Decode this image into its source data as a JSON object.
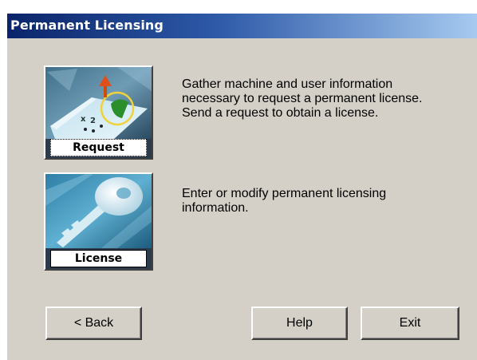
{
  "window": {
    "title": "Permanent Licensing"
  },
  "options": [
    {
      "label": "Request",
      "description": "Gather machine and user information necessary to request a permanent license. Send a request to obtain a license."
    },
    {
      "label": "License",
      "description": "Enter or modify permanent licensing information."
    }
  ],
  "buttons": {
    "back": "< Back",
    "help": "Help",
    "exit": "Exit"
  },
  "colors": {
    "titlebar_start": "#0a246a",
    "titlebar_end": "#a6caf0",
    "dialog_face": "#d4d0c8"
  },
  "icons": {
    "request": "request-document-icon",
    "license": "key-icon"
  }
}
